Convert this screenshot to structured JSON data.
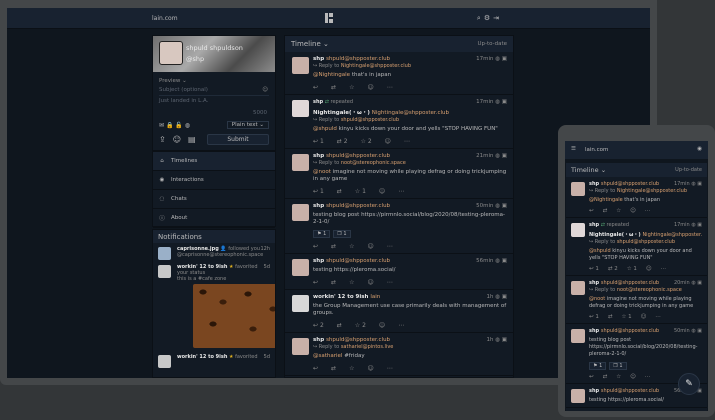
{
  "nav": {
    "site": "lain.com",
    "icons": [
      "search-icon",
      "gear-icon",
      "logout-icon"
    ]
  },
  "user": {
    "name": "shpuld shpuldson",
    "handle": "@shp"
  },
  "post_form": {
    "preview_label": "Preview",
    "subject_placeholder": "Subject (optional)",
    "body_text": "Just landed in L.A.",
    "char_count": "5000",
    "format": "Plain text",
    "submit_label": "Submit"
  },
  "menu": [
    {
      "label": "Timelines",
      "icon": "home-icon"
    },
    {
      "label": "Interactions",
      "icon": "bell-icon"
    },
    {
      "label": "Chats",
      "icon": "chat-icon"
    },
    {
      "label": "About",
      "icon": "info-icon"
    }
  ],
  "notifications": {
    "title": "Notifications",
    "items": [
      {
        "who": "caprisonne.jpg",
        "action": "followed you",
        "time": "12h",
        "acct": "@caprisonne@stereophonic.space"
      },
      {
        "who": "workin' 12 to 9ish",
        "action": "favorited your status",
        "time": "5d",
        "text": "this is a #cafe zone"
      },
      {
        "who": "workin' 12 to 9ish",
        "action": "favorited",
        "time": "5d"
      }
    ]
  },
  "timeline": {
    "title": "Timeline",
    "updated": "Up-to-date",
    "statuses": [
      {
        "name": "shp",
        "acct": "shpuld@shpposter.club",
        "time": "17min",
        "reply_to": "Nightingale@shpposter.club",
        "body_mention": "@Nightingale",
        "body": " that's in japan",
        "actions": [
          "",
          "",
          "",
          ""
        ]
      },
      {
        "retweet_by": "shp",
        "retweet_label": "repeated",
        "name": "Nightingale(・ω・)",
        "acct": "Nightingale@shpposter.club",
        "time": "17min",
        "reply_to": "shpuld@shpposter.club",
        "body_mention": "@shpuld",
        "body": " kinyu kicks down your door and yells \"STOP HAVING FUN\"",
        "actions": [
          "1",
          "2",
          "2",
          ""
        ]
      },
      {
        "name": "shp",
        "acct": "shpuld@shpposter.club",
        "time": "21min",
        "reply_to": "noot@stereophonic.space",
        "body_mention": "@noot",
        "body": " imagine not moving while playing defrag or doing trickjumping in any game",
        "actions": [
          "1",
          "",
          "1",
          ""
        ]
      },
      {
        "name": "shp",
        "acct": "shpuld@shpposter.club",
        "time": "50min",
        "reply_to": "",
        "body_mention": "",
        "body": "testing blog post https://pirmnlo.social/blog/2020/08/testing-pleroma-2-1-0/",
        "reacts": [
          "⚑ 1",
          "❒ 1"
        ],
        "actions": [
          "",
          "",
          "",
          ""
        ]
      },
      {
        "name": "shp",
        "acct": "shpuld@shpposter.club",
        "time": "56min",
        "reply_to": "",
        "body_mention": "",
        "body": "testing https://pleroma.social/",
        "actions": [
          "",
          "",
          "",
          ""
        ]
      },
      {
        "name": "workin' 12 to 9ish",
        "acct": "lain",
        "time": "1h",
        "reply_to": "",
        "body_mention": "",
        "body": "the Group Management use case primarily deals with management of groups.",
        "actions": [
          "2",
          "",
          "2",
          ""
        ]
      },
      {
        "name": "shp",
        "acct": "shpuld@shpposter.club",
        "time": "1h",
        "reply_to": "sathariel@pintos.live",
        "body_mention": "@sathariel",
        "body": " #friday",
        "actions": [
          "",
          "",
          "",
          ""
        ]
      }
    ]
  },
  "phone": {
    "site": "lain.com",
    "title": "Timeline",
    "updated": "Up-to-date",
    "statuses": [
      {
        "name": "shp",
        "acct": "shpuld@shpposter.club",
        "time": "17min",
        "reply_to": "Nightingale@shpposter.club",
        "body_mention": "@Nightingale",
        "body": " that's in japan",
        "actions": [
          "",
          "",
          "",
          ""
        ]
      },
      {
        "retweet_by": "shp",
        "retweet_label": "repeated",
        "name": "Nightingale(・ω・)",
        "acct": "Nightingale@shpposter.club",
        "time": "17min",
        "reply_to": "shpuld@shpposter.club",
        "body_mention": "@shpuld",
        "body": " kinyu kicks down your door and yells \"STOP HAVING FUN\"",
        "actions": [
          "1",
          "2",
          "1",
          ""
        ]
      },
      {
        "name": "shp",
        "acct": "shpuld@shpposter.club",
        "time": "20min",
        "reply_to": "noot@stereophonic.space",
        "body_mention": "@noot",
        "body": " imagine not moving while playing defrag or doing trickjumping in any game",
        "actions": [
          "1",
          "",
          "1",
          ""
        ]
      },
      {
        "name": "shp",
        "acct": "shpuld@shpposter.club",
        "time": "50min",
        "reply_to": "",
        "body_mention": "",
        "body": "testing blog post https://pirmnlo.social/blog/2020/08/testing-pleroma-2-1-0/",
        "reacts": [
          "⚑ 1",
          "❒ 1"
        ],
        "actions": [
          "",
          "",
          "",
          ""
        ]
      },
      {
        "name": "shp",
        "acct": "shpuld@shpposter.club",
        "time": "56min",
        "reply_to": "",
        "body_mention": "",
        "body": "testing https://pleroma.social/",
        "actions": []
      }
    ]
  }
}
